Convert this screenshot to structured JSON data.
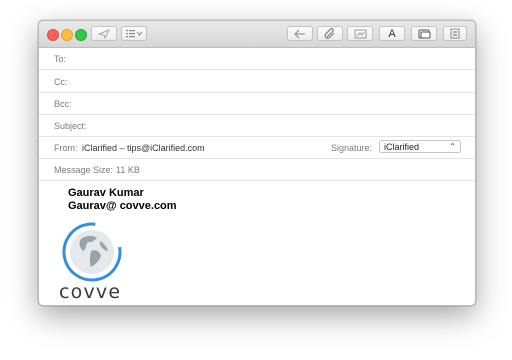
{
  "window": {
    "title_buttons": [
      "close",
      "minimize",
      "zoom"
    ]
  },
  "toolbar": {
    "send_icon": "paper-plane-icon",
    "list_icon": "list-format-icon",
    "reply_icon": "reply-arrow-icon",
    "attach_icon": "paperclip-icon",
    "photo_icon": "photo-browser-icon",
    "font_label": "A",
    "window_icon": "windows-icon",
    "stationery_icon": "stationery-icon"
  },
  "header": {
    "to_label": "To:",
    "to_value": "",
    "cc_label": "Cc:",
    "cc_value": "",
    "bcc_label": "Bcc:",
    "bcc_value": "",
    "subject_label": "Subject:",
    "subject_value": "",
    "from_label": "From:",
    "from_value": "iClarified – tips@iClarified.com",
    "signature_label": "Signature:",
    "signature_value": "iClarified",
    "size_label": "Message Size:",
    "size_value": "11 KB"
  },
  "body": {
    "signature_name": "Gaurav Kumar",
    "signature_email": "Gaurav@ covve.com",
    "logo_text": "covve"
  },
  "colors": {
    "close": "#fc605b",
    "minimize": "#fdbc40",
    "zoom": "#34c84a",
    "logo_ring": "#2f8fe0",
    "globe": "#9aa3aa"
  }
}
